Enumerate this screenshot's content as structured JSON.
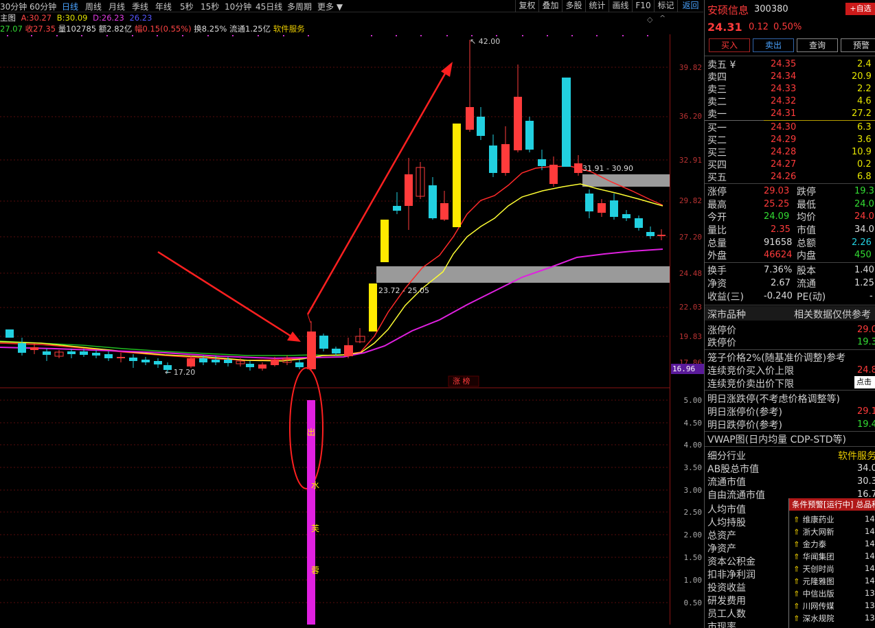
{
  "toolbar": {
    "periods": [
      "30分钟",
      "60分钟",
      "日线",
      "周线",
      "月线",
      "季线",
      "年线",
      "5秒",
      "15秒",
      "10分钟",
      "45日线",
      "多周期",
      "更多"
    ],
    "active_period": "日线",
    "buttons": [
      "复权",
      "叠加",
      "多股",
      "统计",
      "画线",
      "F10",
      "标记",
      "返回"
    ]
  },
  "info": {
    "title": "主图",
    "a_label": "A:",
    "a_val": "30.27",
    "b_label": "B:",
    "b_val": "30.09",
    "d_label": "D:",
    "d_val": "26.23",
    "d_val2": "26.23",
    "row2": [
      "27.07",
      "收27.35",
      "量102785",
      "额2.82亿",
      "幅0.15(0.55%)",
      "换8.25%",
      "流通1.25亿",
      "软件服务"
    ]
  },
  "chart": {
    "annotations": {
      "high": "42.00",
      "low": "17.20",
      "zone1": "31.91 - 30.90",
      "zone2": "23.72 - 25.05",
      "badge": "涨 榜",
      "price_tag": "16.96"
    },
    "ytick_main": [
      "39.82",
      "36.20",
      "32.91",
      "29.82",
      "27.20",
      "24.48",
      "22.03",
      "19.83",
      "17.86"
    ],
    "ytick_sub": [
      "5.00",
      "4.50",
      "4.00",
      "3.50",
      "3.00",
      "2.50",
      "2.00",
      "1.50",
      "1.00",
      "0.50"
    ],
    "sub_chars": [
      "出",
      "水",
      "芙",
      "蓉"
    ]
  },
  "panel": {
    "name": "安硕信息",
    "code": "300380",
    "add_btn": "+自选",
    "price": "24.31",
    "change": "0.12",
    "pct": "0.50%",
    "actions": [
      "买入",
      "卖出",
      "查询",
      "预警"
    ],
    "sells": [
      {
        "label": "卖五",
        "yen": "¥",
        "price": "24.35",
        "vol": "2.4"
      },
      {
        "label": "卖四",
        "price": "24.34",
        "vol": "20.9"
      },
      {
        "label": "卖三",
        "price": "24.33",
        "vol": "2.2"
      },
      {
        "label": "卖二",
        "price": "24.32",
        "vol": "4.6"
      },
      {
        "label": "卖一",
        "price": "24.31",
        "vol": "27.2"
      }
    ],
    "buys": [
      {
        "label": "买一",
        "price": "24.30",
        "vol": "6.3"
      },
      {
        "label": "买二",
        "price": "24.29",
        "vol": "3.6"
      },
      {
        "label": "买三",
        "price": "24.28",
        "vol": "10.9"
      },
      {
        "label": "买四",
        "price": "24.27",
        "vol": "0.2"
      },
      {
        "label": "买五",
        "price": "24.26",
        "vol": "6.8"
      }
    ],
    "stats": [
      {
        "l1": "涨停",
        "v1": "29.03",
        "c1": "#ff3b3b",
        "l2": "跌停",
        "v2": "19.3",
        "c2": "#33dd33"
      },
      {
        "l1": "最高",
        "v1": "25.25",
        "c1": "#ff3b3b",
        "l2": "最低",
        "v2": "24.0",
        "c2": "#33dd33"
      },
      {
        "l1": "今开",
        "v1": "24.09",
        "c1": "#33dd33",
        "l2": "均价",
        "v2": "24.0",
        "c2": "#ff3b3b"
      },
      {
        "l1": "量比",
        "v1": "2.35",
        "c1": "#ff3b3b",
        "l2": "市值",
        "v2": "34.0",
        "c2": "#dddddd"
      },
      {
        "l1": "总量",
        "v1": "91658",
        "c1": "#dddddd",
        "l2": "总额",
        "v2": "2.26",
        "c2": "#22d0e0"
      },
      {
        "l1": "外盘",
        "v1": "46624",
        "c1": "#ff3b3b",
        "l2": "内盘",
        "v2": "450",
        "c2": "#33dd33"
      }
    ],
    "stats2": [
      {
        "l1": "换手",
        "v1": "7.36%",
        "l2": "股本",
        "v2": "1.40"
      },
      {
        "l1": "净资",
        "v1": "2.67",
        "l2": "流通",
        "v2": "1.25"
      },
      {
        "l1": "收益(三)",
        "v1": "-0.240",
        "l2": "PE(动)",
        "v2": "-"
      }
    ],
    "market_label": "深市品种",
    "related": "相关数据仅供参考",
    "limit_up": "涨停价",
    "limit_up_val": "29.0",
    "limit_down": "跌停价",
    "limit_down_val": "19.3",
    "cage": "笼子价格2%(随基准价调整)参考",
    "auction_buy": "连续竞价买入价上限",
    "auction_buy_val": "24.8",
    "auction_sell": "连续竞价卖出价下限",
    "click_btn": "点击",
    "next_day": "明日涨跌停(不考虑价格调整等)",
    "next_up": "明日涨停价(参考)",
    "next_up_val": "29.1",
    "next_down": "明日跌停价(参考)",
    "next_down_val": "19.4",
    "vwap": "VWAP图(日内均量 CDP-STD等)",
    "industry_label": "细分行业",
    "industry_val": "软件服务",
    "ab_label": "AB股总市值",
    "ab_val": "34.0",
    "float_label": "流通市值",
    "float_val": "30.3",
    "free_label": "自由流通市值",
    "free_val": "16.7",
    "more_labels": [
      "人均市值",
      "人均持股",
      "总资产",
      "净资产",
      "资本公积金",
      "扣非净利润",
      "投资收益",
      "研发费用",
      "员工人数",
      "市现率"
    ]
  },
  "alert": {
    "header": "条件预警[运行中] 总品种",
    "items": [
      {
        "name": "维康药业",
        "time": "14:"
      },
      {
        "name": "浙大网新",
        "time": "14:"
      },
      {
        "name": "金力泰",
        "time": "14:"
      },
      {
        "name": "华闻集团",
        "time": "14:"
      },
      {
        "name": "天创时尚",
        "time": "14:"
      },
      {
        "name": "元隆雅图",
        "time": "14:"
      },
      {
        "name": "中信出版",
        "time": "13:"
      },
      {
        "name": "川网传媒",
        "time": "13:"
      },
      {
        "name": "深水规院",
        "time": "13:"
      }
    ]
  }
}
